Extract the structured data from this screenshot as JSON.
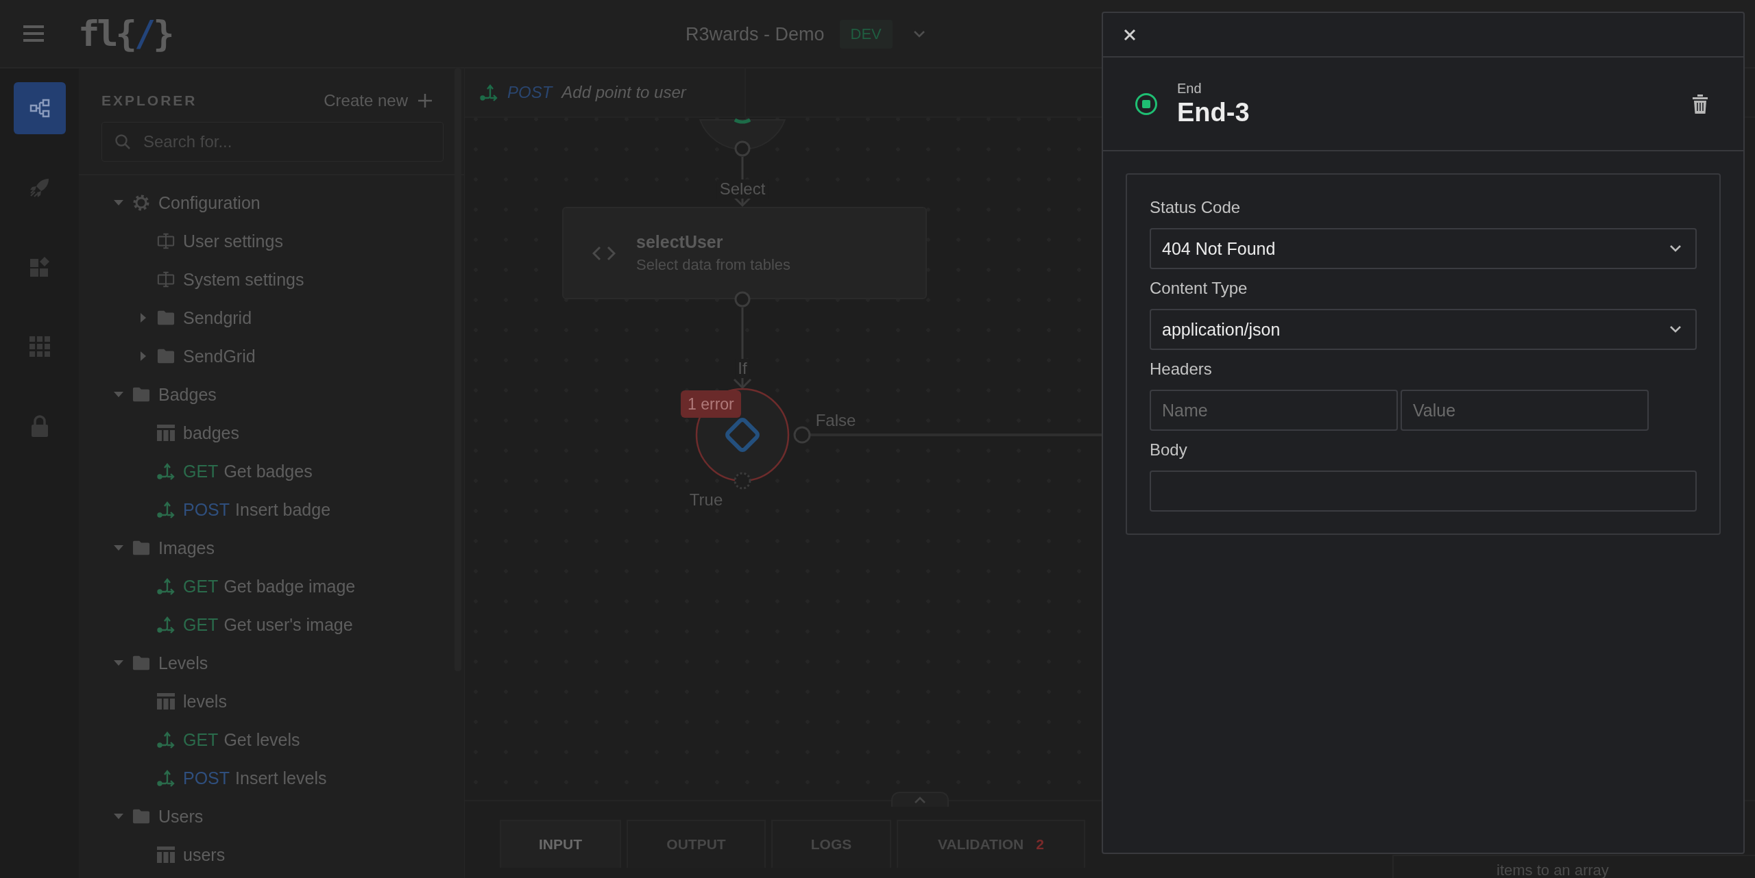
{
  "header": {
    "logo": {
      "prefix": "fl{",
      "mark": "/",
      "suffix": "}"
    },
    "project": "R3wards - Demo",
    "environment": "DEV"
  },
  "rail": [
    {
      "kind": "flow",
      "selected": true
    },
    {
      "kind": "rocket",
      "selected": false
    },
    {
      "kind": "widgets",
      "selected": false
    },
    {
      "kind": "grid",
      "selected": false
    },
    {
      "kind": "lock",
      "selected": false
    }
  ],
  "explorer": {
    "title": "EXPLORER",
    "create_button": "Create new",
    "search": {
      "placeholder": "Search for..."
    },
    "tree": [
      {
        "kind": "group",
        "label": "Configuration",
        "expanded": true,
        "children": [
          {
            "kind": "setting",
            "label": "User settings"
          },
          {
            "kind": "setting",
            "label": "System settings"
          },
          {
            "kind": "folder",
            "label": "Sendgrid",
            "expanded": false
          },
          {
            "kind": "folder",
            "label": "SendGrid",
            "expanded": false
          }
        ]
      },
      {
        "kind": "folder",
        "label": "Badges",
        "expanded": true,
        "children": [
          {
            "kind": "table",
            "label": "badges"
          },
          {
            "kind": "endpoint",
            "method": "GET",
            "color": "#2a6b4b",
            "label": "Get badges"
          },
          {
            "kind": "endpoint",
            "method": "POST",
            "color": "#2f4f7e",
            "label": "Insert badge"
          }
        ]
      },
      {
        "kind": "folder",
        "label": "Images",
        "expanded": true,
        "children": [
          {
            "kind": "endpoint",
            "method": "GET",
            "color": "#2a6b4b",
            "label": "Get badge image"
          },
          {
            "kind": "endpoint",
            "method": "GET",
            "color": "#2a6b4b",
            "label": "Get user's image"
          }
        ]
      },
      {
        "kind": "folder",
        "label": "Levels",
        "expanded": true,
        "children": [
          {
            "kind": "table",
            "label": "levels"
          },
          {
            "kind": "endpoint",
            "method": "GET",
            "color": "#2a6b4b",
            "label": "Get levels"
          },
          {
            "kind": "endpoint",
            "method": "POST",
            "color": "#2f4f7e",
            "label": "Insert levels"
          }
        ]
      },
      {
        "kind": "folder",
        "label": "Users",
        "expanded": true,
        "children": [
          {
            "kind": "table",
            "label": "users"
          }
        ]
      }
    ]
  },
  "canvas": {
    "breadcrumb": {
      "method": "POST",
      "label": "Add point to user"
    },
    "nodes": [
      {
        "kind": "start"
      },
      {
        "kind": "function",
        "incoming_label": "Select",
        "title": "selectUser",
        "subtitle": "Select data from tables"
      },
      {
        "kind": "condition",
        "incoming_label": "If",
        "error_badge": "1 error",
        "false_label": "False",
        "true_label": "True"
      }
    ]
  },
  "bottom_tabs": [
    {
      "label": "INPUT",
      "selected": true
    },
    {
      "label": "OUTPUT",
      "selected": false
    },
    {
      "label": "LOGS",
      "selected": false
    },
    {
      "label": "VALIDATION",
      "selected": false,
      "count": "2"
    }
  ],
  "side_text": "items to an array",
  "drawer": {
    "node_type": "End",
    "node_name": "End-3",
    "fields": [
      {
        "kind": "select",
        "label": "Status Code",
        "value": "404 Not Found"
      },
      {
        "kind": "select",
        "label": "Content Type",
        "value": "application/json"
      },
      {
        "kind": "pair",
        "label": "Headers",
        "placeholders": [
          "Name",
          "Value"
        ]
      },
      {
        "kind": "textarea",
        "label": "Body"
      }
    ]
  }
}
